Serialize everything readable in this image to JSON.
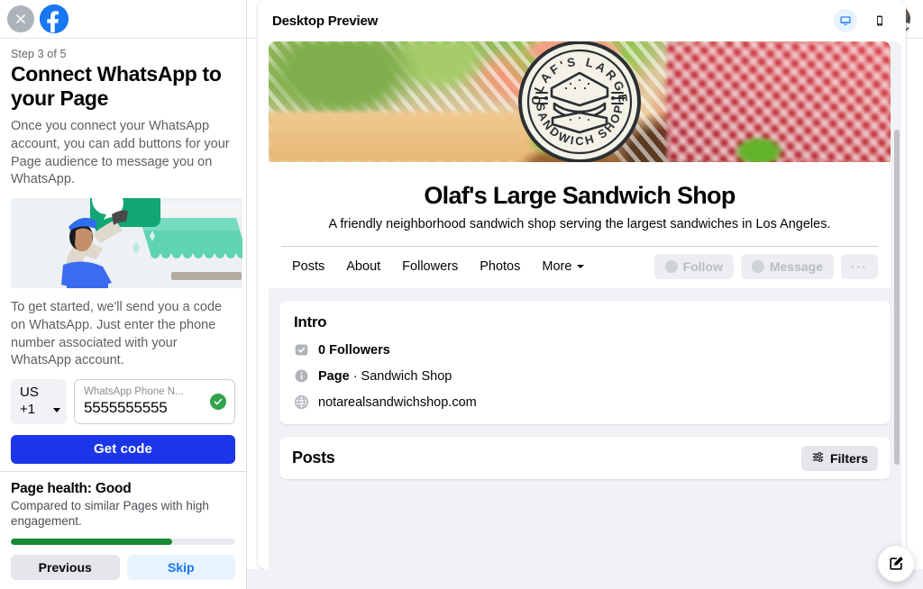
{
  "left_panel": {
    "close_icon": "close-icon",
    "brand_icon": "facebook-logo",
    "step_label": "Step 3 of 5",
    "title": "Connect WhatsApp to your Page",
    "paragraph_1": "Once you connect your WhatsApp account, you can add buttons for your Page audience to message you on WhatsApp.",
    "illustration_name": "whatsapp-storefront-illustration",
    "paragraph_2": "To get started, we'll send you a code on WhatsApp. Just enter the phone number associated with your WhatsApp account.",
    "country_select": {
      "country": "US",
      "dial_code": "+1"
    },
    "phone_field": {
      "label": "WhatsApp Phone N...",
      "value": "5555555555",
      "valid": true
    },
    "primary_button": "Get code",
    "footer": {
      "health_title": "Page health: Good",
      "health_subtitle": "Compared to similar Pages with high engagement.",
      "progress_percent": 72,
      "previous_button": "Previous",
      "skip_button": "Skip"
    }
  },
  "topbar": {
    "menu_icon": "grid-menu-icon",
    "messenger_icon": "messenger-icon",
    "notifications_icon": "bell-icon",
    "avatar": "user-avatar",
    "avatar_caret": "chevron-down-icon"
  },
  "preview": {
    "header_title": "Desktop Preview",
    "device_desktop_icon": "desktop-monitor-icon",
    "device_mobile_icon": "mobile-phone-icon",
    "active_device": "desktop",
    "cover_photo": "sandwich-cover-photo",
    "logo": {
      "name": "olafs-large-sandwich-shop-logo",
      "top_text": "OLAF'S LARGE",
      "bottom_text": "SANDWICH SHOP"
    },
    "page_name": "Olaf's Large Sandwich Shop",
    "page_description": "A friendly neighborhood sandwich shop serving the largest sandwiches in Los Angeles.",
    "tabs": [
      {
        "label": "Posts"
      },
      {
        "label": "About"
      },
      {
        "label": "Followers"
      },
      {
        "label": "Photos"
      },
      {
        "label": "More",
        "has_caret": true
      }
    ],
    "actions": [
      {
        "label": "Follow",
        "icon": "follow-plus-icon",
        "disabled": true
      },
      {
        "label": "Message",
        "icon": "messenger-icon",
        "disabled": true
      },
      {
        "label": "···",
        "icon": "more-options-icon",
        "disabled": true
      }
    ],
    "intro": {
      "title": "Intro",
      "rows": [
        {
          "icon": "followers-badge-icon",
          "text": "0 Followers",
          "bold": "0 Followers",
          "rest": ""
        },
        {
          "icon": "info-circle-icon",
          "text": "Page · Sandwich Shop",
          "bold": "Page",
          "rest": " · Sandwich Shop"
        },
        {
          "icon": "globe-icon",
          "text": "notarealsandwichshop.com",
          "bold": "",
          "rest": "notarealsandwichshop.com"
        }
      ]
    },
    "posts_section": {
      "title": "Posts",
      "filters_label": "Filters",
      "filters_icon": "sliders-icon"
    }
  },
  "compose_fab": {
    "icon": "compose-edit-icon"
  },
  "colors": {
    "accent_blue": "#1877f2",
    "primary_button_blue": "#1b35e8",
    "health_green": "#1a8a35",
    "valid_green": "#31a24c",
    "page_bg": "#f0f2f5"
  }
}
